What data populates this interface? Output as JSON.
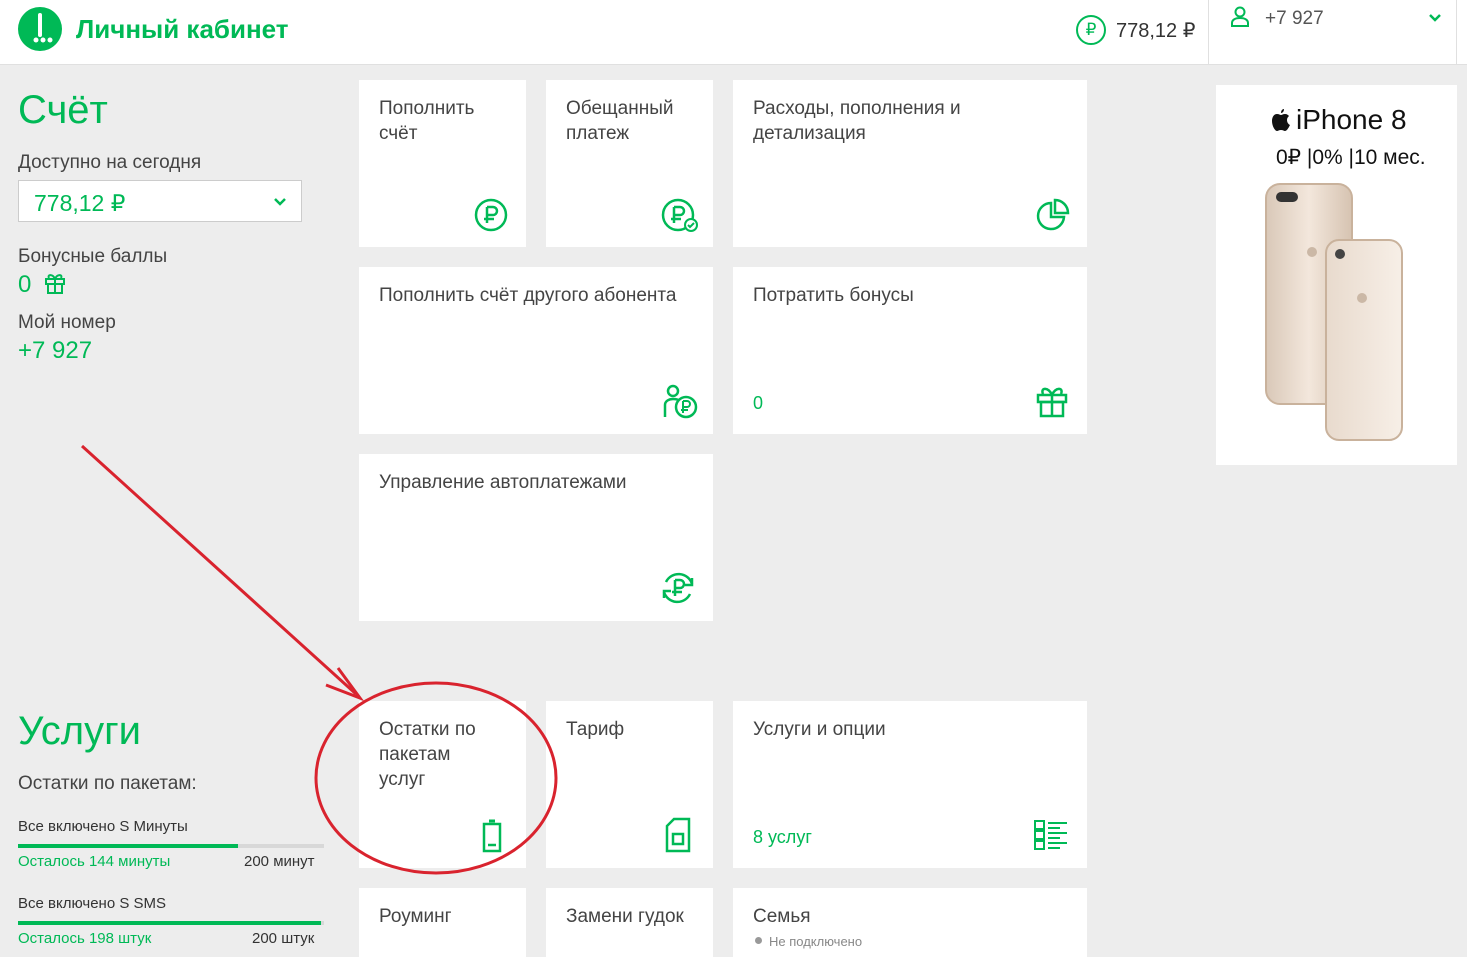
{
  "header": {
    "brand": "Личный кабинет",
    "balance": "778,12 ₽",
    "ruble_symbol": "₽",
    "phone": "+7 927"
  },
  "account": {
    "title": "Счёт",
    "available_label": "Доступно на сегодня",
    "available_value": "778,12 ₽",
    "bonus_label": "Бонусные баллы",
    "bonus_value": "0",
    "number_label": "Мой номер",
    "number_value": "+7 927"
  },
  "account_cards": [
    {
      "title": "Пополнить\nсчёт",
      "icon": "ruble-circle-icon"
    },
    {
      "title": "Обещанный\nплатеж",
      "icon": "ruble-check-icon"
    },
    {
      "title": "Расходы, пополнения и\nдетализация",
      "icon": "pie-chart-icon"
    },
    {
      "title": "Пополнить счёт другого абонента",
      "icon": "person-ruble-icon"
    },
    {
      "title": "Потратить бонусы",
      "sub": "0",
      "icon": "gift-icon"
    },
    {
      "title": "Управление автоплатежами",
      "icon": "autopay-cycle-icon"
    }
  ],
  "services": {
    "title": "Услуги",
    "packages_label": "Остатки по пакетам:",
    "packages": [
      {
        "name": "Все включено S Минуты",
        "left": "Осталось 144 минуты",
        "total": "200 минут",
        "fraction": 0.72
      },
      {
        "name": "Все включено S SMS",
        "left": "Осталось 198 штук",
        "total": "200 штук",
        "fraction": 0.99
      }
    ]
  },
  "service_cards": [
    {
      "title": "Остатки по\nпакетам\nуслуг",
      "icon": "battery-icon"
    },
    {
      "title": "Тариф",
      "icon": "sim-card-icon"
    },
    {
      "title": "Услуги и опции",
      "sub": "8 услуг",
      "icon": "options-list-icon"
    },
    {
      "title": "Роуминг"
    },
    {
      "title": "Замени гудок"
    },
    {
      "title": "Семья",
      "status": "Не подключено"
    }
  ],
  "ad": {
    "title": "iPhone 8",
    "terms": "0₽ |0% |10 мес."
  },
  "colors": {
    "accent": "#00b956",
    "annotation": "#d9232e",
    "background": "#ededed"
  }
}
